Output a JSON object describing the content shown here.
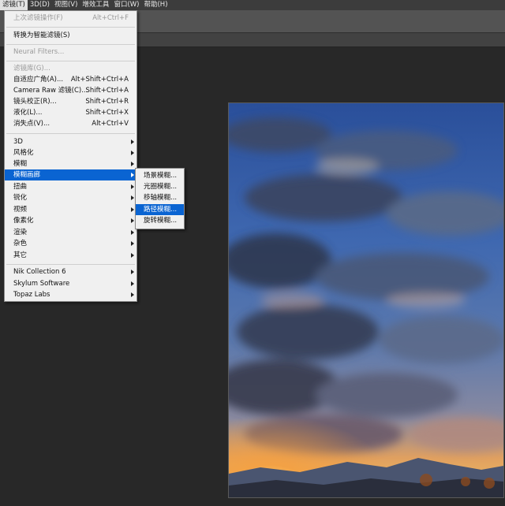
{
  "menubar": [
    {
      "label": "滤镜(T)",
      "active": true
    },
    {
      "label": "3D(D)"
    },
    {
      "label": "视图(V)"
    },
    {
      "label": "增效工具"
    },
    {
      "label": "窗口(W)"
    },
    {
      "label": "帮助(H)"
    }
  ],
  "filter_menu": {
    "last_filter": {
      "label": "上次滤镜操作(F)",
      "shortcut": "Alt+Ctrl+F"
    },
    "smart_filter": {
      "label": "转换为智能滤镜(S)"
    },
    "neural_filters": {
      "label": "Neural Filters..."
    },
    "filter_gallery": {
      "label": "滤镜库(G)..."
    },
    "adaptive_wide_angle": {
      "label": "自适应广角(A)...",
      "shortcut": "Alt+Shift+Ctrl+A"
    },
    "camera_raw": {
      "label": "Camera Raw 滤镜(C)...",
      "shortcut": "Shift+Ctrl+A"
    },
    "lens_correction": {
      "label": "镜头校正(R)...",
      "shortcut": "Shift+Ctrl+R"
    },
    "liquify": {
      "label": "液化(L)...",
      "shortcut": "Shift+Ctrl+X"
    },
    "vanishing_point": {
      "label": "消失点(V)...",
      "shortcut": "Alt+Ctrl+V"
    },
    "3d": {
      "label": "3D"
    },
    "stylize": {
      "label": "风格化"
    },
    "blur": {
      "label": "模糊"
    },
    "blur_gallery": {
      "label": "模糊画廊"
    },
    "distort": {
      "label": "扭曲"
    },
    "sharpen": {
      "label": "锐化"
    },
    "video": {
      "label": "视频"
    },
    "pixelate": {
      "label": "像素化"
    },
    "render": {
      "label": "渲染"
    },
    "noise": {
      "label": "杂色"
    },
    "other": {
      "label": "其它"
    },
    "nik": {
      "label": "Nik Collection 6"
    },
    "skylum": {
      "label": "Skylum Software"
    },
    "topaz": {
      "label": "Topaz Labs"
    }
  },
  "blur_gallery_submenu": [
    {
      "label": "场景模糊..."
    },
    {
      "label": "光圈模糊..."
    },
    {
      "label": "移轴模糊..."
    },
    {
      "label": "路径模糊..."
    },
    {
      "label": "旋转模糊..."
    }
  ],
  "colors": {
    "highlight": "#0a64d2",
    "menu_bg": "#f0f0f0",
    "app_bg": "#282828"
  }
}
